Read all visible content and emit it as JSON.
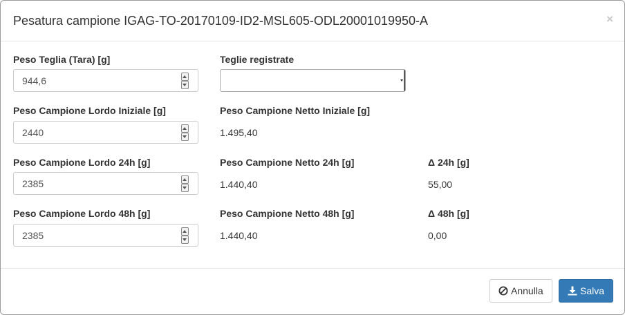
{
  "dialog": {
    "title": "Pesatura campione IGAG-TO-20170109-ID2-MSL605-ODL20001019950-A",
    "close_symbol": "×"
  },
  "form": {
    "tara": {
      "label": "Peso Teglia (Tara) [g]",
      "value": "944,6"
    },
    "teglie": {
      "label": "Teglie registrate",
      "selected": ""
    },
    "lordo_iniziale": {
      "label": "Peso Campione Lordo Iniziale [g]",
      "value": "2440"
    },
    "netto_iniziale": {
      "label": "Peso Campione Netto Iniziale [g]",
      "value": "1.495,40"
    },
    "lordo_24h": {
      "label": "Peso Campione Lordo 24h [g]",
      "value": "2385"
    },
    "netto_24h": {
      "label": "Peso Campione Netto 24h [g]",
      "value": "1.440,40"
    },
    "delta_24h": {
      "label": "Δ 24h [g]",
      "value": "55,00"
    },
    "lordo_48h": {
      "label": "Peso Campione Lordo 48h [g]",
      "value": "2385"
    },
    "netto_48h": {
      "label": "Peso Campione Netto 48h [g]",
      "value": "1.440,40"
    },
    "delta_48h": {
      "label": "Δ 48h [g]",
      "value": "0,00"
    }
  },
  "footer": {
    "cancel_label": "Annulla",
    "cancel_icon": "ban-icon",
    "save_label": "Salva",
    "save_icon": "download-icon"
  },
  "colors": {
    "primary": "#337ab7",
    "text": "#333333",
    "border": "#cccccc"
  }
}
